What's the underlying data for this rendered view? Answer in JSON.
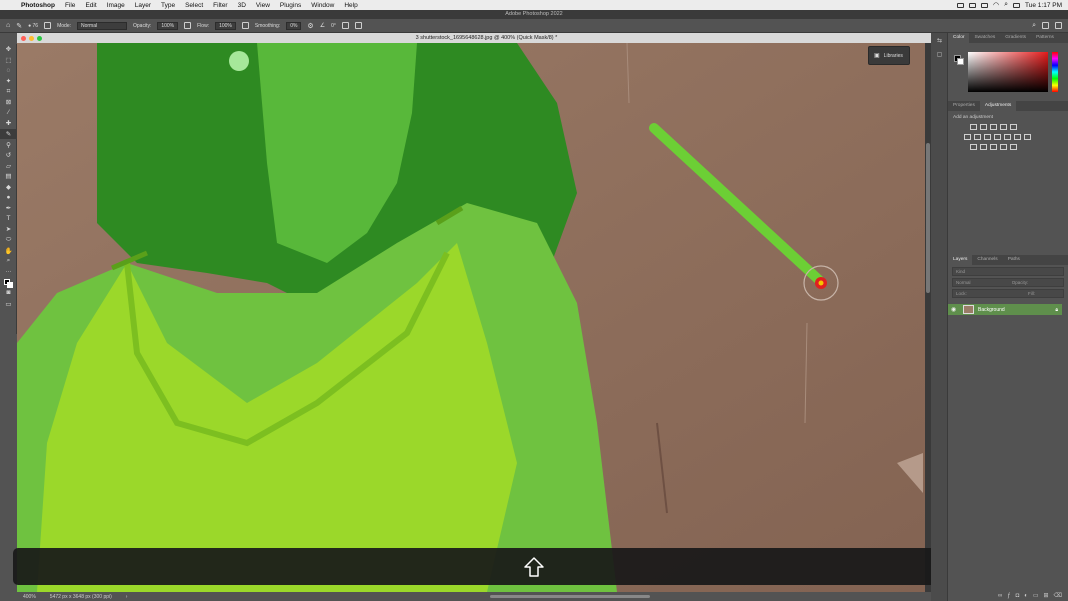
{
  "menubar": {
    "app": "Photoshop",
    "items": [
      "File",
      "Edit",
      "Image",
      "Layer",
      "Type",
      "Select",
      "Filter",
      "3D",
      "View",
      "Plugins",
      "Window",
      "Help"
    ],
    "clock": "Tue 1:17 PM"
  },
  "window_title": "Adobe Photoshop 2022",
  "options": {
    "brush_size": "76",
    "mode_label": "Mode:",
    "mode_value": "Normal",
    "opacity_label": "Opacity:",
    "opacity_value": "100%",
    "flow_label": "Flow:",
    "flow_value": "100%",
    "smoothing_label": "Smoothing:",
    "smoothing_value": "0%",
    "angle_value": "0°"
  },
  "document": {
    "title": "3 shutterstock_1695648628.jpg @ 400% (Quick Mask/8) *",
    "zoom": "400%",
    "info": "5472 px x 3648 px (300 ppi)"
  },
  "libraries_label": "Libraries",
  "panels": {
    "color_tabs": [
      "Color",
      "Swatches",
      "Gradients",
      "Patterns"
    ],
    "adj_tabs": [
      "Properties",
      "Adjustments"
    ],
    "adj_hint": "Add an adjustment",
    "layers_tabs": [
      "Layers",
      "Channels",
      "Paths"
    ],
    "kind_placeholder": "Kind",
    "blend_mode": "Normal",
    "opacity_label": "Opacity:",
    "lock_label": "Lock:",
    "fill_label": "Fill:",
    "layer_name": "Background"
  },
  "colors": {
    "mask_green": "#7ed321",
    "brush_stroke": "#6ccf35",
    "cursor_red": "#e02020",
    "layer_highlight": "#5f8f4c"
  },
  "overlay_icon": "shift-arrow-up-icon"
}
